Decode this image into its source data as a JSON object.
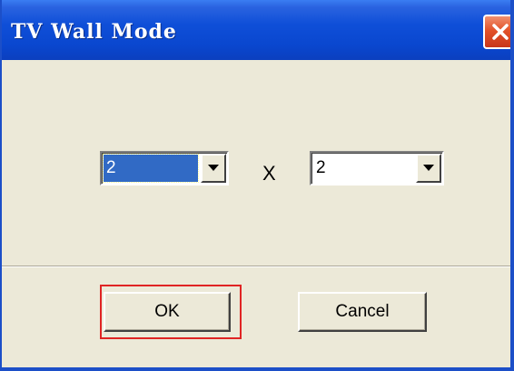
{
  "window": {
    "title": "TV Wall Mode",
    "close_icon": "close-icon"
  },
  "grid": {
    "rows_value": "2",
    "separator": "X",
    "cols_value": "2",
    "dropdown_icon": "chevron-down-icon"
  },
  "buttons": {
    "ok_label": "OK",
    "cancel_label": "Cancel"
  },
  "colors": {
    "titlebar": "#0a47cf",
    "close_button": "#e2522a",
    "dialog_bg": "#ece9d8",
    "selection": "#316ac5",
    "focus_highlight": "#e02424"
  }
}
